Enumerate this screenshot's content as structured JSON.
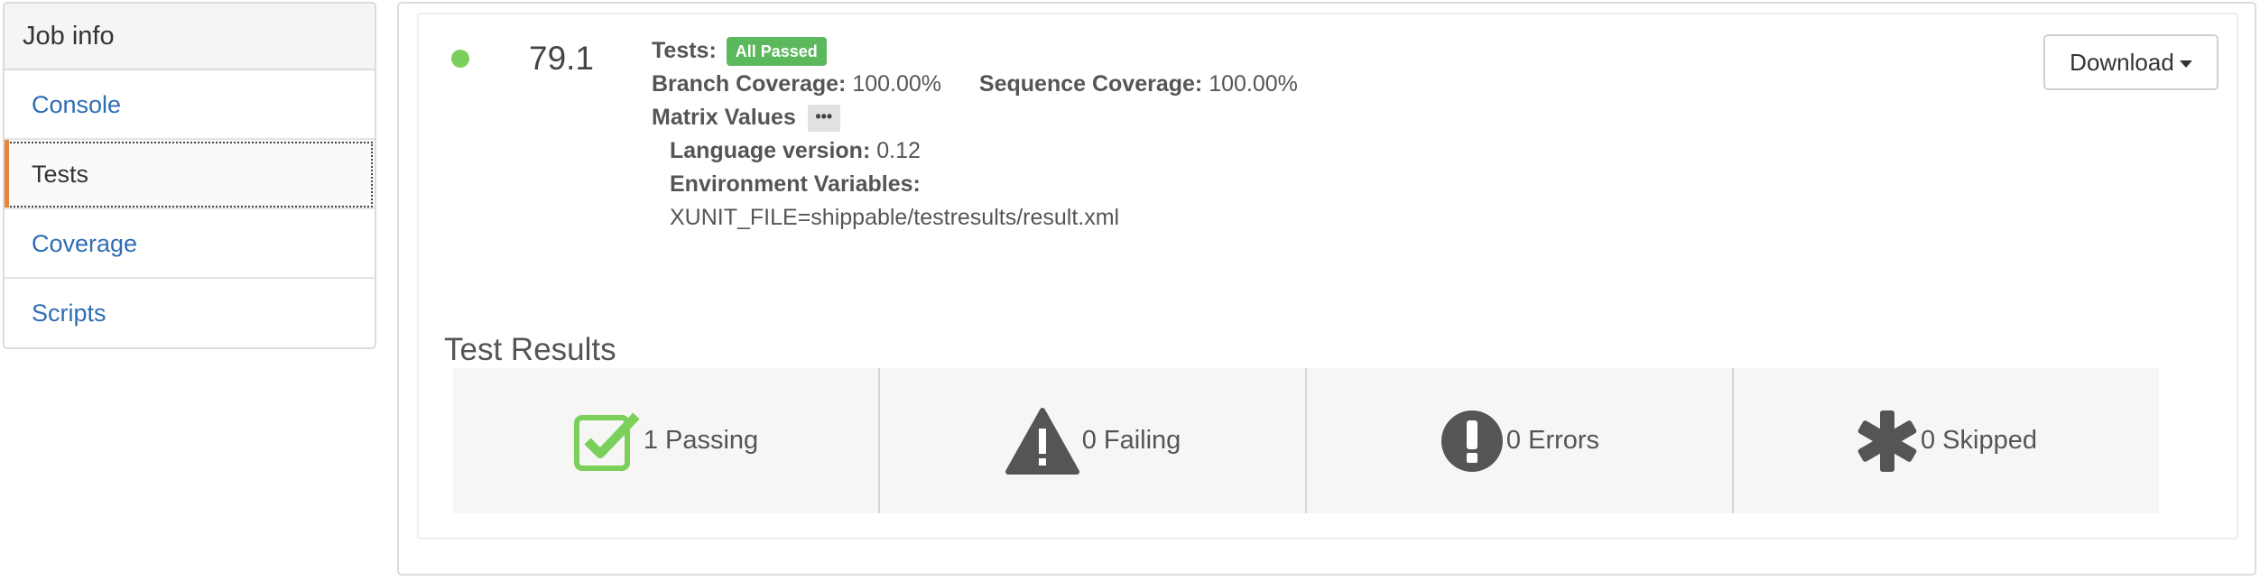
{
  "sidebar": {
    "header": "Job info",
    "items": [
      {
        "label": "Console"
      },
      {
        "label": "Tests"
      },
      {
        "label": "Coverage"
      },
      {
        "label": "Scripts"
      }
    ]
  },
  "job": {
    "status_color": "#7ad05b",
    "build_number": "79.1",
    "tests_label": "Tests:",
    "tests_badge": "All Passed",
    "branch_coverage_label": "Branch Coverage:",
    "branch_coverage_value": "100.00%",
    "sequence_coverage_label": "Sequence Coverage:",
    "sequence_coverage_value": "100.00%",
    "matrix_label": "Matrix Values",
    "matrix_more": "•••",
    "language_label": "Language version:",
    "language_value": "0.12",
    "env_label": "Environment Variables:",
    "env_value": "XUNIT_FILE=shippable/testresults/result.xml"
  },
  "download": {
    "label": "Download"
  },
  "results": {
    "title": "Test Results",
    "items": [
      {
        "label": "1 Passing",
        "icon": "checkbox-icon",
        "color": "#7ad05b"
      },
      {
        "label": "0 Failing",
        "icon": "warning-icon",
        "color": "#555555"
      },
      {
        "label": "0 Errors",
        "icon": "exclamation-circle-icon",
        "color": "#555555"
      },
      {
        "label": "0 Skipped",
        "icon": "asterisk-icon",
        "color": "#555555"
      }
    ]
  }
}
